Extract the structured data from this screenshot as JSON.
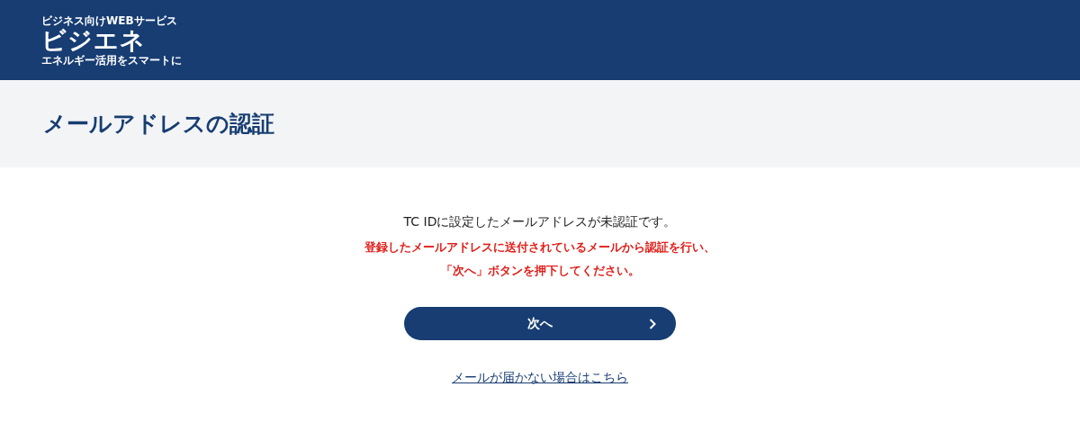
{
  "header": {
    "logo": {
      "tagline": "ビジネス向けWEBサービス",
      "name": "ビジエネ",
      "subline": "エネルギー活用をスマートに"
    }
  },
  "page_title": "メールアドレスの認証",
  "message": "TC IDに設定したメールアドレスが未認証です。",
  "warning_lines": [
    "登録したメールアドレスに送付されているメールから認証を行い、",
    "「次へ」ボタンを押下してください。"
  ],
  "next_button": {
    "label": "次へ"
  },
  "help_link": "メールが届かない場合はこちら"
}
